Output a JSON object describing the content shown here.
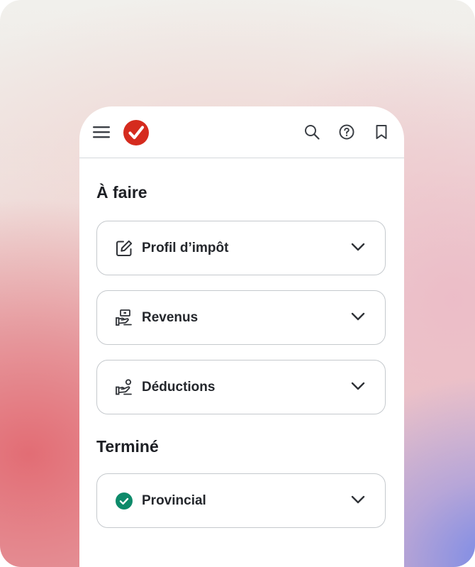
{
  "app": {
    "brand_color": "#d52b1e",
    "success_color": "#0d8a6a"
  },
  "topbar": {
    "menu_icon": "hamburger-menu-icon",
    "logo_icon": "checkmark-logo-icon",
    "actions": [
      "search-icon",
      "help-icon",
      "bookmark-icon"
    ]
  },
  "todo": {
    "title": "À faire",
    "items": [
      {
        "label": "Profil d’impôt",
        "icon": "edit-icon"
      },
      {
        "label": "Revenus",
        "icon": "hand-money-icon"
      },
      {
        "label": "Déductions",
        "icon": "hand-person-icon"
      }
    ]
  },
  "done": {
    "title": "Terminé",
    "items": [
      {
        "label": "Provincial",
        "icon": "check-circle-icon"
      }
    ]
  }
}
